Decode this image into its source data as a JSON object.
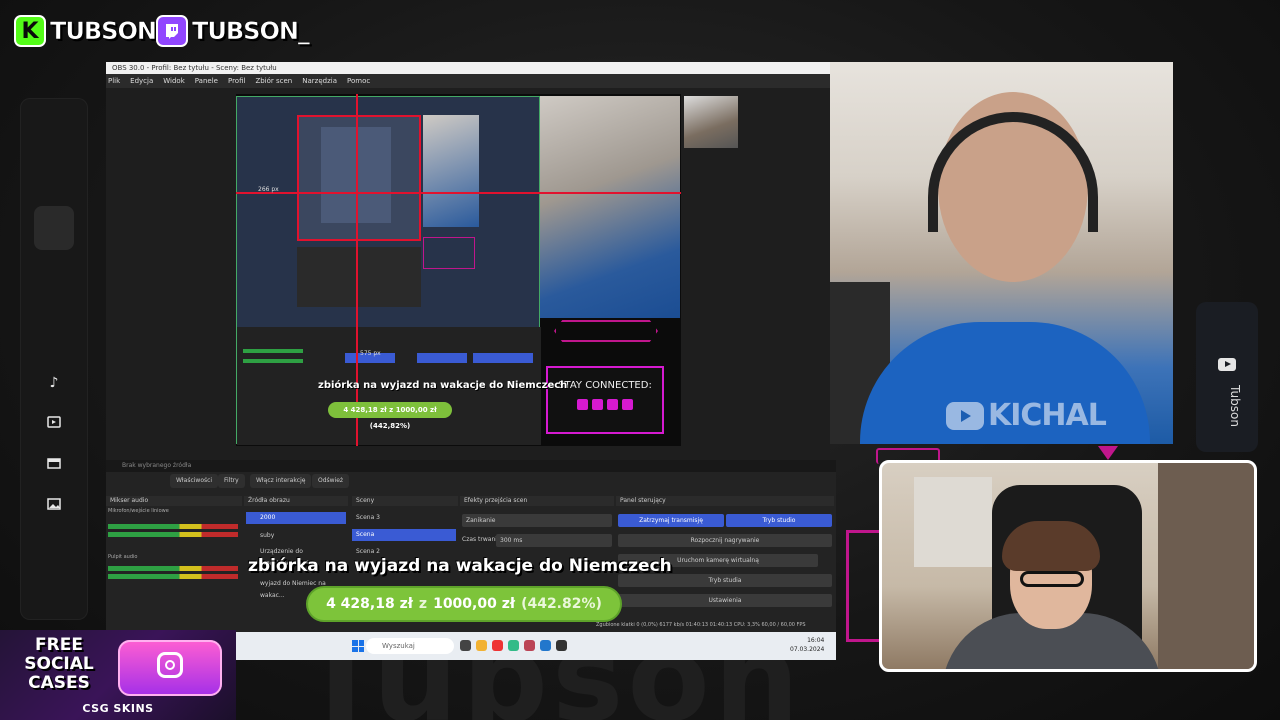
{
  "socials": {
    "kick_letter": "K",
    "kick_name": "TUBSON",
    "twitch_name": "TUBSON_",
    "kick_color": "#53fc18",
    "twitch_color": "#9146ff"
  },
  "sidebar_icons": [
    "music-icon",
    "video-icon",
    "calendar-icon",
    "image-icon"
  ],
  "right_panel": {
    "channel_name": "Tubson",
    "icon": "youtube-icon"
  },
  "obs": {
    "window_title": "OBS 30.0 - Profil: Bez tytułu - Sceny: Bez tytułu",
    "menu": [
      "Plik",
      "Edycja",
      "Widok",
      "Panele",
      "Profil",
      "Zbiór scen",
      "Narzędzia",
      "Pomoc"
    ],
    "guide_label_left": "266 px",
    "guide_label_bottom": "575 px",
    "inner_caption": "zbiórka na wyjazd na wakacje do Niemczech",
    "inner_progress": "4 428,18 zł z 1000,00 zł (442,82%)",
    "stay_connected": "STAY CONNECTED:",
    "no_source": "Brak wybranego źródła",
    "toolbar": [
      "Właściwości",
      "Filtry",
      "Włącz interakcję",
      "Odśwież"
    ],
    "docks": {
      "mixer_title": "Mikser audio",
      "sources_title": "Źródła obrazu",
      "scenes_title": "Sceny",
      "transitions_title": "Efekty przejścia scen",
      "controls_title": "Panel sterujący"
    },
    "sources": [
      "2000",
      "suby",
      "Urządzenie do przechwytywania",
      "wyjazd do Niemiec na wakac..."
    ],
    "mixer_tracks": [
      "Mikrofon/wejście liniowe",
      "Pulpit audio"
    ],
    "scenes": [
      "Scena 3",
      "Scena",
      "Scena 2"
    ],
    "transition": "Zanikanie",
    "duration_label": "Czas trwania",
    "duration_value": "300 ms",
    "controls": [
      "Zatrzymaj transmisję",
      "Tryb studio",
      "Rozpocznij nagrywanie",
      "Uruchom kamerę wirtualną",
      "Tryb studia",
      "Ustawienia"
    ],
    "status_bar": "Zgubione klatki 0 (0,0%)   6177 kb/s   01:40:13   01:40:13   CPU: 3,3%   60,00 / 60,00 FPS",
    "taskbar_search": "Wyszukaj",
    "clock_time": "16:04",
    "clock_date": "07.03.2024"
  },
  "overlay": {
    "caption": "zbiórka na wyjazd na wakacje do Niemczech",
    "progress_current": "4 428,18 zł",
    "progress_sep": "z",
    "progress_goal": "1000,00 zł",
    "progress_percent": "(442.82%)",
    "progress_fraction": 1.0
  },
  "webcam": {
    "watermark": "KICHAL"
  },
  "promo": {
    "line1": "FREE",
    "line2": "SOCIAL",
    "line3": "CASES",
    "brand": "CSG SKINS"
  },
  "background_word": "Tubson",
  "colors": {
    "accent_magenta": "#c0168c",
    "progress_green": "#7dc43a",
    "obs_selection": "#3a5bd4"
  }
}
